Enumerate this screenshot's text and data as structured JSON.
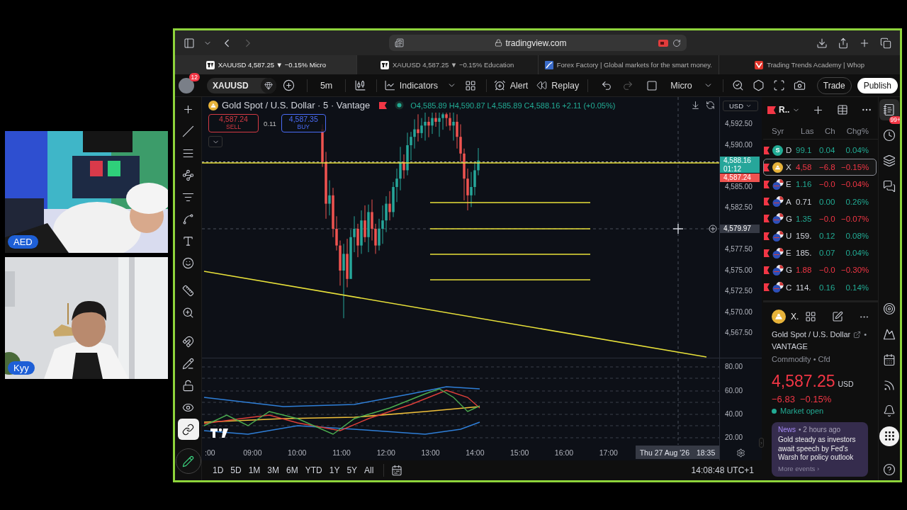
{
  "video_tiles": [
    {
      "label": "AED"
    },
    {
      "label": "Kyy"
    }
  ],
  "browser": {
    "address": "tradingview.com",
    "tabs": [
      {
        "title": "XAUUSD 4,587.25 ▼ −0.15% Micro",
        "kind": "chart",
        "selected": true
      },
      {
        "title": "XAUUSD 4,587.25 ▼ −0.15% Education",
        "kind": "chart",
        "selected": false
      },
      {
        "title": "Forex Factory | Global markets for the smart money.",
        "kind": "square",
        "selected": false
      },
      {
        "title": "Trading Trends Academy | Whop",
        "kind": "mark",
        "selected": false
      }
    ]
  },
  "toolbar": {
    "notifications": "12",
    "symbol": "XAUUSD",
    "interval": "5m",
    "indicators": "Indicators",
    "alert": "Alert",
    "replay": "Replay",
    "layout": "Micro",
    "trade": "Trade",
    "publish": "Publish"
  },
  "drawing_tools": [
    {
      "selected": false
    },
    {
      "selected": false
    },
    {
      "selected": false
    },
    {
      "selected": false
    },
    {
      "selected": false
    },
    {
      "selected": false
    },
    {
      "selected": false
    },
    {
      "selected": false
    },
    {
      "selected": false
    },
    {
      "selected": false
    },
    {
      "selected": false
    },
    {
      "selected": false
    },
    {
      "selected": false
    },
    {
      "selected": false
    },
    {
      "selected": true
    }
  ],
  "chart": {
    "title": "Gold Spot / U.S. Dollar · 5 · Vantage",
    "ohlc": "O4,585.89 H4,590.87 L4,585.89 C4,588.16 +2.11 (+0.05%)",
    "sell": {
      "price": "4,587.24",
      "label": "SELL"
    },
    "spread": "0.11",
    "buy": {
      "price": "4,587.35",
      "label": "BUY"
    },
    "currency": "USD",
    "price_ticks": [
      "4,592.50",
      "4,590.00",
      "4,585.00",
      "4,582.50",
      "4,577.50",
      "4,575.00",
      "4,572.50",
      "4,570.00",
      "4,567.50"
    ],
    "last_price": {
      "price": "4,588.16",
      "countdown": "01:12"
    },
    "bid_price": "4,587.24",
    "crosshair_price": "4,579.97",
    "indicator_ticks": [
      "80.00",
      "60.00",
      "40.00",
      "20.00"
    ],
    "time_ticks": [
      ":00",
      "09:00",
      "10:00",
      "11:00",
      "12:00",
      "13:00",
      "14:00",
      "15:00",
      "16:00",
      "17:00"
    ],
    "crosshair_time": {
      "date": "Thu 27 Aug '26",
      "time": "18:35"
    }
  },
  "ranges": [
    "1D",
    "5D",
    "1M",
    "3M",
    "6M",
    "YTD",
    "1Y",
    "5Y",
    "All"
  ],
  "clock": "14:08:48 UTC+1",
  "watchlist": {
    "title": "R..",
    "columns": [
      "Syr",
      "Las",
      "Ch",
      "Chg%"
    ],
    "rows": [
      {
        "kind": "letter",
        "icon_text": "S",
        "symbol": "D",
        "last": "99.1",
        "change": "0.04",
        "change_pct": "0.04%",
        "last_up": true,
        "last_down": false,
        "falling": false,
        "selected": false
      },
      {
        "kind": "coin",
        "symbol": "X",
        "last": "4,58",
        "change": "−6.8",
        "change_pct": "−0.15%",
        "last_up": false,
        "last_down": true,
        "falling": true,
        "selected": true
      },
      {
        "kind": "pair",
        "symbol": "E",
        "last": "1.16",
        "change": "−0.0",
        "change_pct": "−0.04%",
        "last_up": true,
        "last_down": false,
        "falling": true,
        "selected": false
      },
      {
        "kind": "pair",
        "symbol": "A",
        "last": "0.71",
        "change": "0.00",
        "change_pct": "0.26%",
        "last_up": false,
        "last_down": false,
        "falling": false,
        "selected": false
      },
      {
        "kind": "pair",
        "symbol": "G",
        "last": "1.35",
        "change": "−0.0",
        "change_pct": "−0.07%",
        "last_up": true,
        "last_down": false,
        "falling": true,
        "selected": false
      },
      {
        "kind": "pair",
        "symbol": "U",
        "last": "159.",
        "change": "0.12",
        "change_pct": "0.08%",
        "last_up": false,
        "last_down": false,
        "falling": false,
        "selected": false
      },
      {
        "kind": "pair",
        "symbol": "E",
        "last": "185.",
        "change": "0.07",
        "change_pct": "0.04%",
        "last_up": false,
        "last_down": false,
        "falling": false,
        "selected": false
      },
      {
        "kind": "pair",
        "symbol": "G",
        "last": "1.88",
        "change": "−0.0",
        "change_pct": "−0.30%",
        "last_up": false,
        "last_down": true,
        "falling": true,
        "selected": false
      },
      {
        "kind": "pair",
        "symbol": "C",
        "last": "114.",
        "change": "0.16",
        "change_pct": "0.14%",
        "last_up": false,
        "last_down": false,
        "falling": false,
        "selected": false
      }
    ]
  },
  "detail": {
    "symbol": "X.",
    "name": "Gold Spot / U.S. Dollar",
    "separator": "•",
    "exchange": "VANTAGE",
    "category": "Commodity • Cfd",
    "price": "4,587.25",
    "currency": "USD",
    "change": "−6.83",
    "change_pct": "−0.15%",
    "falling": true,
    "market_status": "Market open",
    "market_open": true,
    "news": {
      "label": "News",
      "time": "• 2 hours ago",
      "headline": "Gold steady as investors await speech by Fed's Warsh for policy outlook",
      "more": "More events ›"
    }
  },
  "sidebar": {
    "badge": "99+",
    "icons": [
      {
        "selected": true
      },
      {
        "selected": false
      },
      {
        "selected": false
      },
      {
        "selected": false
      },
      {
        "selected": false
      },
      {
        "selected": false
      },
      {
        "selected": false
      },
      {
        "selected": false
      },
      {
        "selected": false
      },
      {
        "selected": false
      },
      {
        "selected": false
      }
    ]
  }
}
